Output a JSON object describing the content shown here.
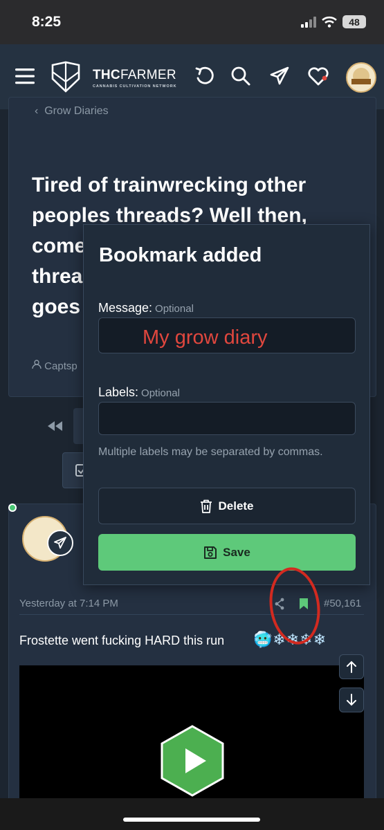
{
  "status_bar": {
    "time": "8:25",
    "battery": "48"
  },
  "navbar": {
    "brand_name_bold": "THC",
    "brand_name_thin": "FARMER",
    "brand_tagline": "CANNABIS CULTIVATION NETWORK"
  },
  "thread": {
    "breadcrumb": "Grow Diaries",
    "title": "Tired of trainwrecking other peoples threads? Well then, come on in! The Trainwreck thread to wreck with. Anything goes here!",
    "author": "Captsp"
  },
  "post": {
    "timestamp": "Yesterday at 7:14 PM",
    "number": "#50,161",
    "text": "Frostette went fucking HARD this run",
    "emojis": "🥶❄❄❄❄"
  },
  "bookmark_dialog": {
    "title": "Bookmark added",
    "message_label": "Message:",
    "message_optional": "Optional",
    "message_value": "My grow diary",
    "labels_label": "Labels:",
    "labels_optional": "Optional",
    "labels_value": "",
    "labels_hint": "Multiple labels may be separated by commas.",
    "delete_label": "Delete",
    "save_label": "Save"
  },
  "colors": {
    "accent_green": "#5ec97a",
    "annotation_red": "#d22a20",
    "background": "#1c2530"
  }
}
